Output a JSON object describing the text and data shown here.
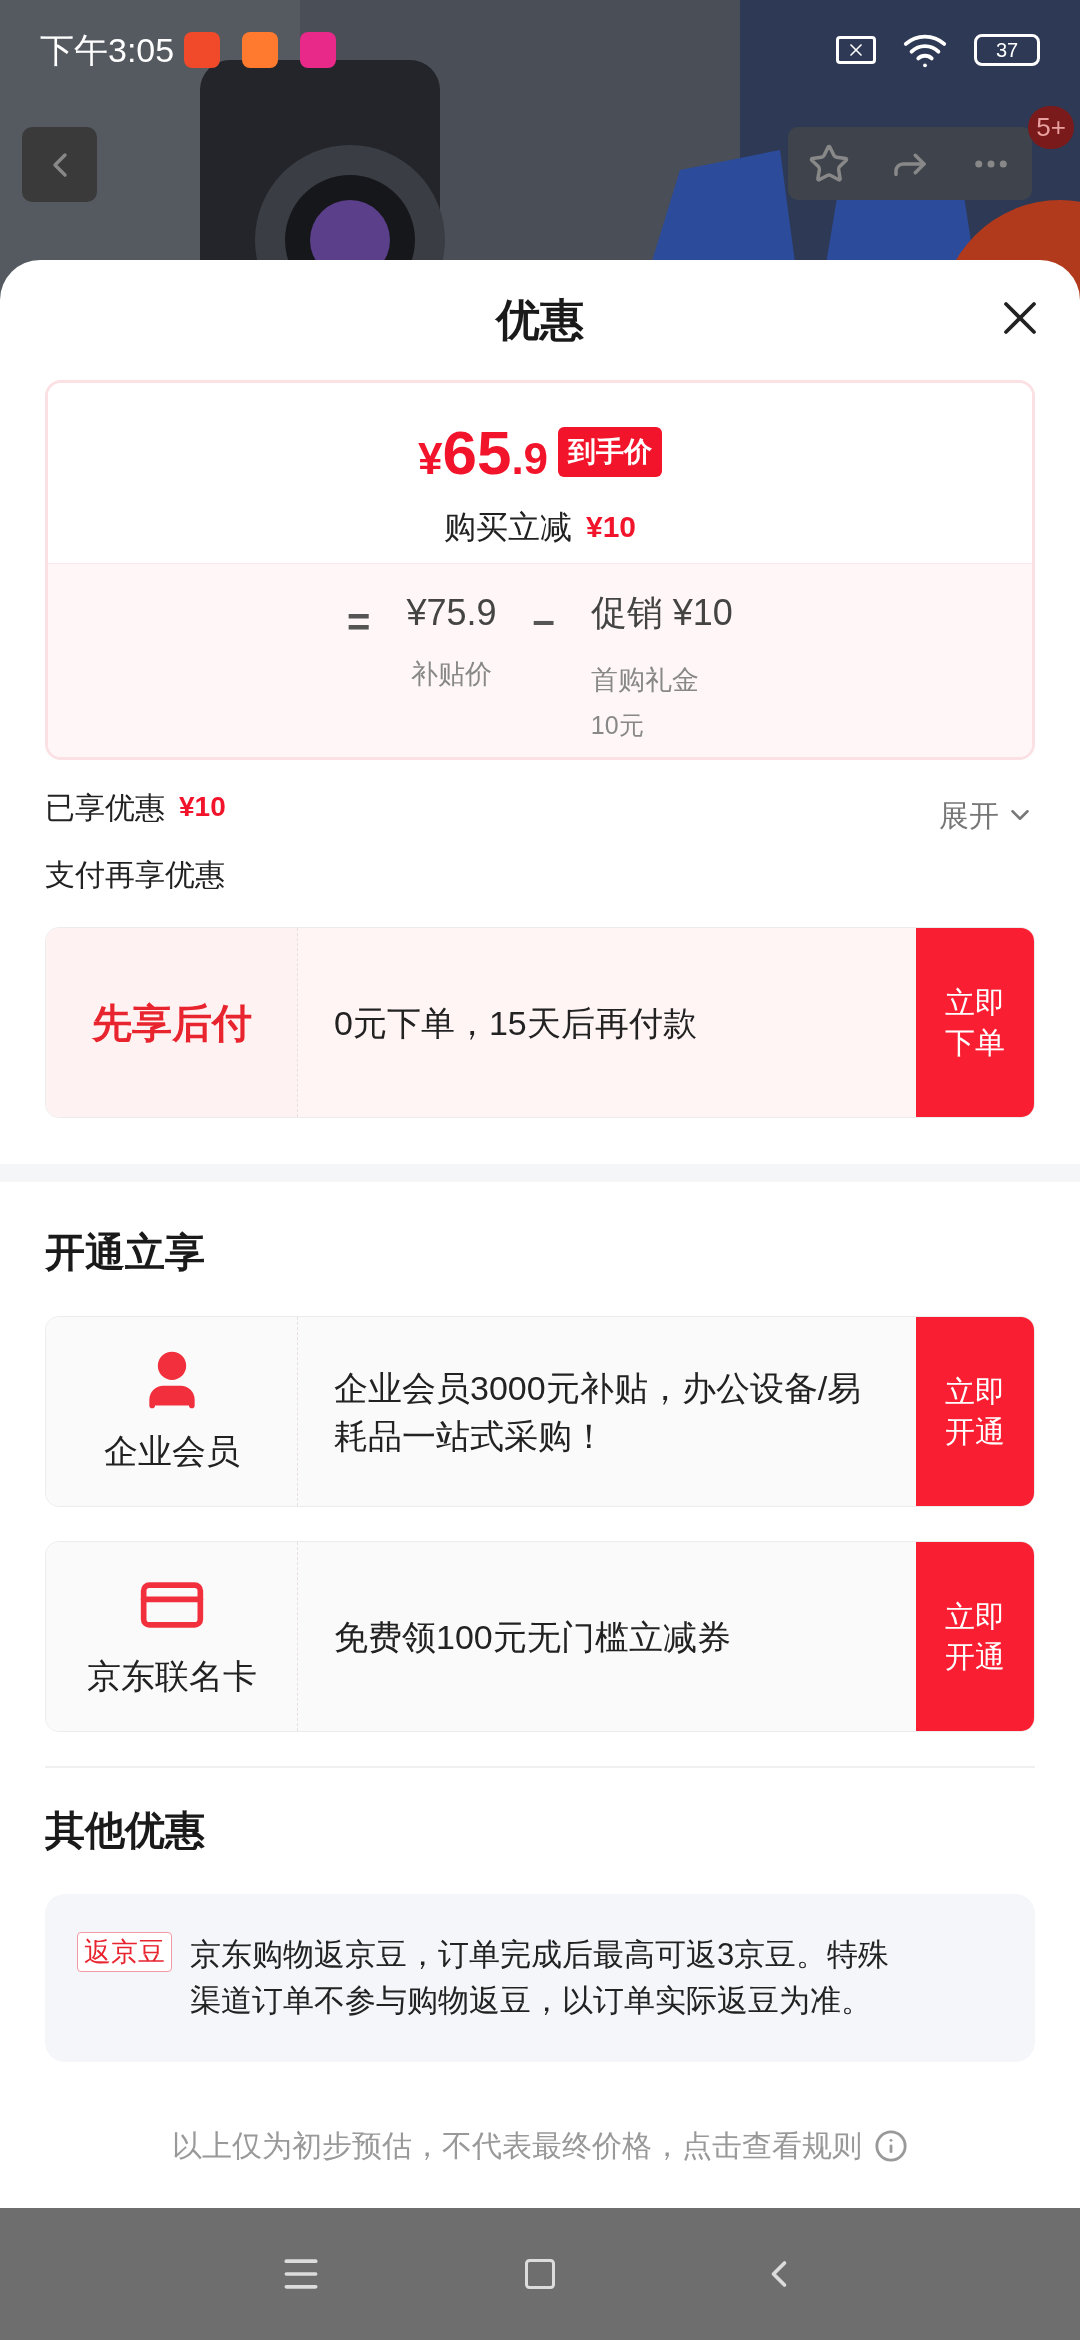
{
  "status_bar": {
    "time": "下午3:05",
    "battery": "37"
  },
  "top_bar": {
    "badge": "5+"
  },
  "sheet": {
    "title": "优惠"
  },
  "price_card": {
    "currency": "¥",
    "final_int": "65",
    "final_dec": ".9",
    "final_tag": "到手价",
    "instant_label": "购买立减",
    "instant_amount": "¥10",
    "equals": "=",
    "base_value": "¥75.9",
    "base_label": "补贴价",
    "minus": "–",
    "discount_value": "促销 ¥10",
    "discount_label": "首购礼金",
    "discount_amount": "10元"
  },
  "enjoyed": {
    "label": "已享优惠",
    "amount": "¥10",
    "toggle": "展开"
  },
  "pay_section": {
    "title": "支付再享优惠",
    "offers": [
      {
        "kind": "text",
        "name": "先享后付",
        "description": "0元下单，15天后再付款",
        "button": "立即下单"
      }
    ]
  },
  "membership": {
    "title": "开通立享",
    "offers": [
      {
        "kind": "member",
        "name": "企业会员",
        "description": "企业会员3000元补贴，办公设备/易耗品一站式采购！",
        "button": "立即开通"
      },
      {
        "kind": "card",
        "name": "京东联名卡",
        "description": "免费领100元无门槛立减券",
        "button": "立即开通"
      }
    ]
  },
  "other": {
    "title": "其他优惠",
    "items": [
      {
        "tag": "返京豆",
        "text": "京东购物返京豆，订单完成后最高可返3京豆。特殊渠道订单不参与购物返豆，以订单实际返豆为准。"
      }
    ]
  },
  "footer_note": "以上仅为初步预估，不代表最终价格，点击查看规则"
}
